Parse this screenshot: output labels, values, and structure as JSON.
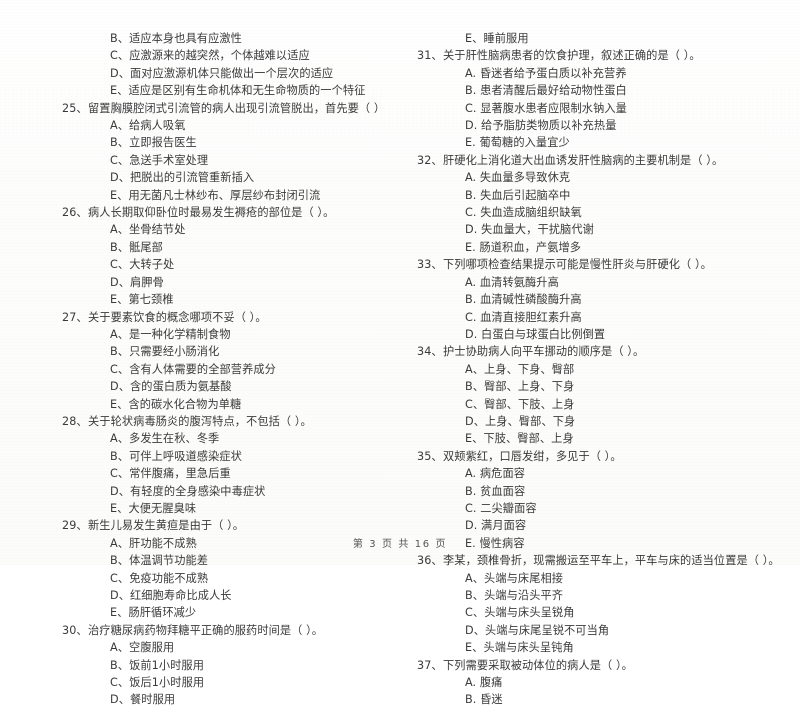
{
  "document": {
    "kind": "scanned-exam-paper",
    "footer": "第 3 页 共 16 页"
  },
  "left_column": {
    "orphan_options": [
      "B、适应本身也具有应激性",
      "C、应激源来的越突然，个体越难以适应",
      "D、面对应激源机体只能做出一个层次的适应",
      "E、适应是区别有生命机体和无生命物质的一个特征"
    ],
    "questions": [
      {
        "number": "25、",
        "stem": "留置胸膜腔闭式引流管的病人出现引流管脱出，首先要（      ）",
        "options": [
          "A、给病人吸氧",
          "B、立即报告医生",
          "C、急送手术室处理",
          "D、把脱出的引流管重新插入",
          "E、用无菌凡士林纱布、厚层纱布封闭引流"
        ]
      },
      {
        "number": "26、",
        "stem": "病人长期取仰卧位时最易发生褥疮的部位是（      ）。",
        "options": [
          "A、坐骨结节处",
          "B、骶尾部",
          "C、大转子处",
          "D、肩胛骨",
          "E、第七颈椎"
        ]
      },
      {
        "number": "27、",
        "stem": "关于要素饮食的概念哪项不妥（      ）。",
        "options": [
          "A、是一种化学精制食物",
          "B、只需要经小肠消化",
          "C、含有人体需要的全部营养成分",
          "D、含的蛋白质为氨基酸",
          "E、含的碳水化合物为单糖"
        ]
      },
      {
        "number": "28、",
        "stem": "关于轮状病毒肠炎的腹泻特点，不包括（      ）。",
        "options": [
          "A、多发生在秋、冬季",
          "B、可伴上呼吸道感染症状",
          "C、常伴腹痛，里急后重",
          "D、有轻度的全身感染中毒症状",
          "E、大便无腥臭味"
        ]
      },
      {
        "number": "29、",
        "stem": "新生儿易发生黄疸是由于（      ）。",
        "options": [
          "A、肝功能不成熟",
          "B、体温调节功能差",
          "C、免疫功能不成熟",
          "D、红细胞寿命比成人长",
          "E、肠肝循环减少"
        ]
      },
      {
        "number": "30、",
        "stem": "治疗糖尿病药物拜糖平正确的服药时间是（      ）。",
        "options": [
          "A、空腹服用",
          "B、饭前1小时服用",
          "C、饭后1小时服用",
          "D、餐时服用"
        ]
      }
    ]
  },
  "right_column": {
    "orphan_options": [
      "E、睡前服用"
    ],
    "questions": [
      {
        "number": "31、",
        "stem": "关于肝性脑病患者的饮食护理，叙述正确的是（      ）。",
        "options": [
          "A. 昏迷者给予蛋白质以补充营养",
          "B. 患者清醒后最好给动物性蛋白",
          "C. 显著腹水患者应限制水钠入量",
          "D. 给予脂肪类物质以补充热量",
          "E. 葡萄糖的入量宜少"
        ]
      },
      {
        "number": "32、",
        "stem": "肝硬化上消化道大出血诱发肝性脑病的主要机制是（      ）。",
        "options": [
          "A. 失血量多导致休克",
          "B. 失血后引起脑卒中",
          "C. 失血造成脑组织缺氧",
          "D. 失血量大，干扰脑代谢",
          "E. 肠道积血，产氨增多"
        ]
      },
      {
        "number": "33、",
        "stem": "下列哪项检查结果提示可能是慢性肝炎与肝硬化（      ）。",
        "options": [
          "A. 血清转氨酶升高",
          "B. 血清碱性磷酸酶升高",
          "C. 血清直接胆红素升高",
          "D. 白蛋白与球蛋白比例倒置"
        ]
      },
      {
        "number": "34、",
        "stem": "护士协助病人向平车挪动的顺序是（      ）。",
        "options": [
          "A、上身、下身、臀部",
          "B、臀部、上身、下身",
          "C、臀部、下肢、上身",
          "D、上身、臀部、下身",
          "E、下肢、臀部、上身"
        ]
      },
      {
        "number": "35、",
        "stem": "双颊紫红，口唇发绀，多见于（      ）。",
        "options": [
          "A. 病危面容",
          "B. 贫血面容",
          "C. 二尖瓣面容",
          "D. 满月面容",
          "E. 慢性病容"
        ]
      },
      {
        "number": "36、",
        "stem": "李某，颈椎骨折，现需搬运至平车上，平车与床的适当位置是（      ）。",
        "options": [
          "A、头端与床尾相接",
          "B、头端与沿头平齐",
          "C、头端与床头呈锐角",
          "D、头端与床尾呈锐不可当角",
          "E、头端与床头呈钝角"
        ]
      },
      {
        "number": "37、",
        "stem": "下列需要采取被动体位的病人是（      ）。",
        "options": [
          "A. 腹痛",
          "B. 昏迷"
        ]
      }
    ]
  }
}
